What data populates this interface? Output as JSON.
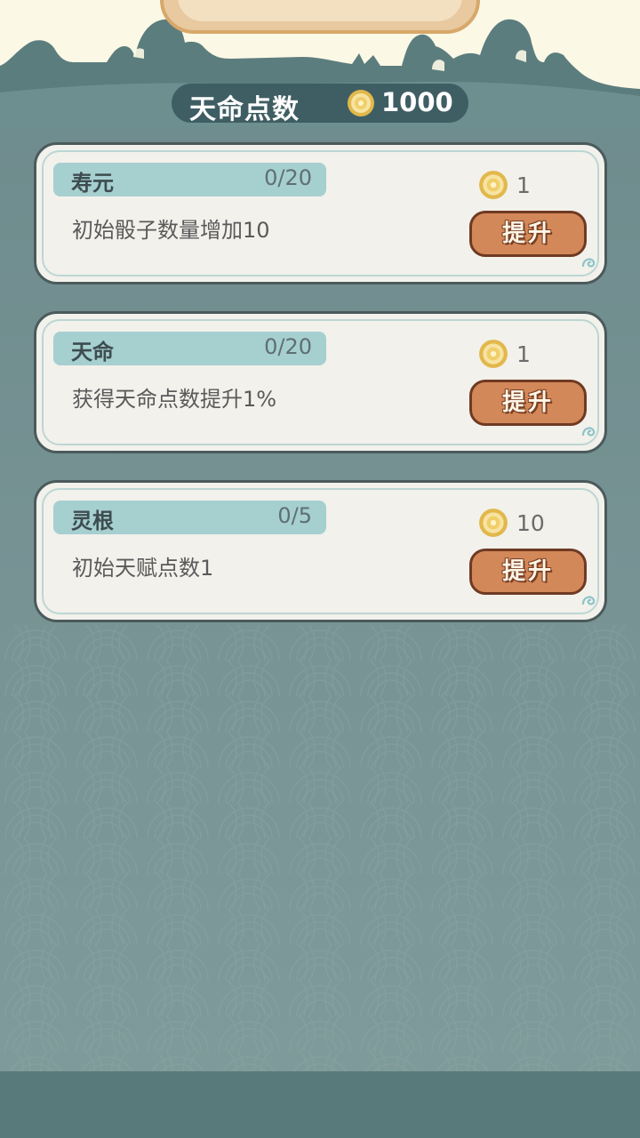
{
  "points": {
    "label": "天命点数",
    "value": "1000",
    "icon": "coin-icon"
  },
  "colors": {
    "panel": "#7a9696",
    "header_bg": "#fbf8e6",
    "skyline": "#5c7d7e",
    "button": "#d38859",
    "tab": "#a6cfd0"
  },
  "upgrades": [
    {
      "name": "寿元",
      "level": "0/20",
      "desc": "初始骰子数量增加10",
      "cost": "1",
      "button": "提升"
    },
    {
      "name": "天命",
      "level": "0/20",
      "desc": "获得天命点数提升1%",
      "cost": "1",
      "button": "提升"
    },
    {
      "name": "灵根",
      "level": "0/5",
      "desc": "初始天赋点数1",
      "cost": "10",
      "button": "提升"
    }
  ]
}
